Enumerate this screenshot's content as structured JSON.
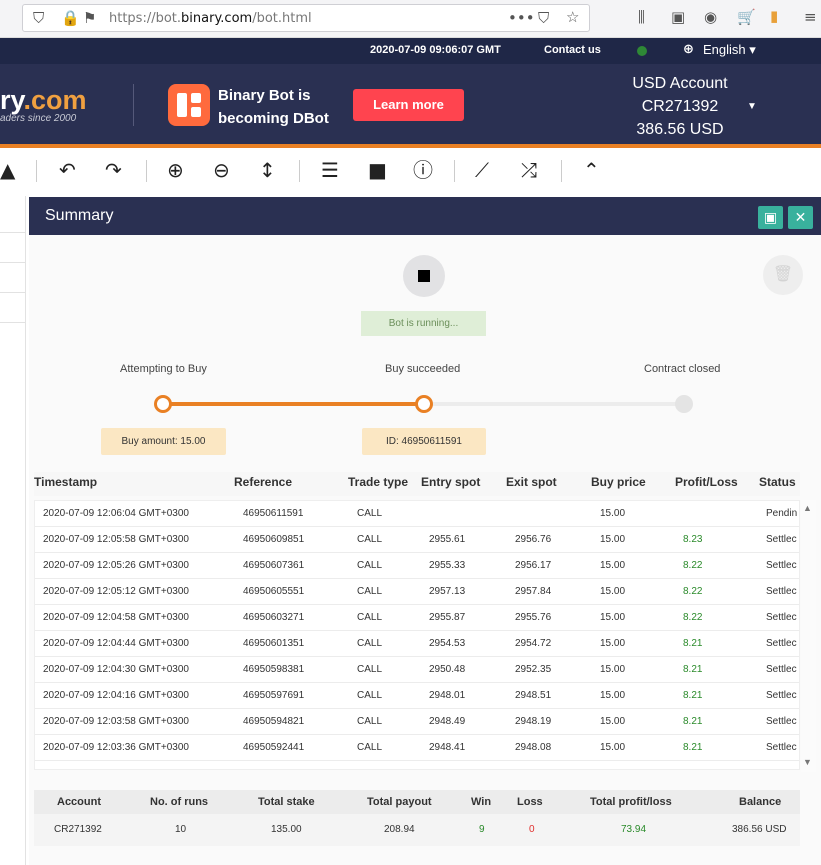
{
  "browser": {
    "url_prefix": "https://bot.",
    "url_domain": "binary.com",
    "url_path": "/bot.html",
    "icons": [
      "shield-icon",
      "lock-icon",
      "permissions-icon",
      "more-icon",
      "pocket-icon",
      "star-icon",
      "library-icon",
      "sidebar-icon",
      "account-icon",
      "cart-icon",
      "flag-icon",
      "menu-icon"
    ]
  },
  "topbar": {
    "datetime": "2020-07-09 09:06:07 GMT",
    "contact": "Contact us",
    "language": "English ▾"
  },
  "header": {
    "logo_left": "ry",
    "logo_right": ".com",
    "logo_sub": "aders since 2000",
    "promo_line1": "Binary Bot is",
    "promo_line2": "becoming DBot",
    "learn_more": "Learn more",
    "account_type": "USD Account",
    "account_id": "CR271392",
    "balance": "386.56 USD"
  },
  "toolbar": {
    "icons": [
      "drive-icon",
      "undo-icon",
      "redo-icon",
      "zoom-in-icon",
      "zoom-out-icon",
      "sort-icon",
      "logs-icon",
      "stop-icon",
      "info-icon",
      "chart-icon",
      "tradingview-icon",
      "collapse-icon"
    ]
  },
  "summary": {
    "title": "Summary",
    "status": "Bot is running...",
    "steps": [
      "Attempting to Buy",
      "Buy succeeded",
      "Contract closed"
    ],
    "buy_amount_tip": "Buy amount: 15.00",
    "id_tip": "ID: 46950611591",
    "progress_steps_completed": 2
  },
  "colors": {
    "header_bg": "#2a3052",
    "accent_orange": "#e98024",
    "learn_btn": "#ff444f",
    "profit_green": "#2a8a2a",
    "loss_red": "#e0302e"
  },
  "trades": {
    "columns": [
      "Timestamp",
      "Reference",
      "Trade type",
      "Entry spot",
      "Exit spot",
      "Buy price",
      "Profit/Loss",
      "Status"
    ],
    "rows": [
      [
        "2020-07-09 12:06:04 GMT+0300",
        "46950611591",
        "CALL",
        "",
        "",
        "15.00",
        "",
        "Pendin"
      ],
      [
        "2020-07-09 12:05:58 GMT+0300",
        "46950609851",
        "CALL",
        "2955.61",
        "2956.76",
        "15.00",
        "8.23",
        "Settlec"
      ],
      [
        "2020-07-09 12:05:26 GMT+0300",
        "46950607361",
        "CALL",
        "2955.33",
        "2956.17",
        "15.00",
        "8.22",
        "Settlec"
      ],
      [
        "2020-07-09 12:05:12 GMT+0300",
        "46950605551",
        "CALL",
        "2957.13",
        "2957.84",
        "15.00",
        "8.22",
        "Settlec"
      ],
      [
        "2020-07-09 12:04:58 GMT+0300",
        "46950603271",
        "CALL",
        "2955.87",
        "2955.76",
        "15.00",
        "8.22",
        "Settlec"
      ],
      [
        "2020-07-09 12:04:44 GMT+0300",
        "46950601351",
        "CALL",
        "2954.53",
        "2954.72",
        "15.00",
        "8.21",
        "Settlec"
      ],
      [
        "2020-07-09 12:04:30 GMT+0300",
        "46950598381",
        "CALL",
        "2950.48",
        "2952.35",
        "15.00",
        "8.21",
        "Settlec"
      ],
      [
        "2020-07-09 12:04:16 GMT+0300",
        "46950597691",
        "CALL",
        "2948.01",
        "2948.51",
        "15.00",
        "8.21",
        "Settlec"
      ],
      [
        "2020-07-09 12:03:58 GMT+0300",
        "46950594821",
        "CALL",
        "2948.49",
        "2948.19",
        "15.00",
        "8.21",
        "Settlec"
      ],
      [
        "2020-07-09 12:03:36 GMT+0300",
        "46950592441",
        "CALL",
        "2948.41",
        "2948.08",
        "15.00",
        "8.21",
        "Settlec"
      ]
    ]
  },
  "totals": {
    "columns": [
      "Account",
      "No. of runs",
      "Total stake",
      "Total payout",
      "Win",
      "Loss",
      "Total profit/loss",
      "Balance"
    ],
    "values": [
      "CR271392",
      "10",
      "135.00",
      "208.94",
      "9",
      "0",
      "73.94",
      "386.56 USD"
    ]
  }
}
